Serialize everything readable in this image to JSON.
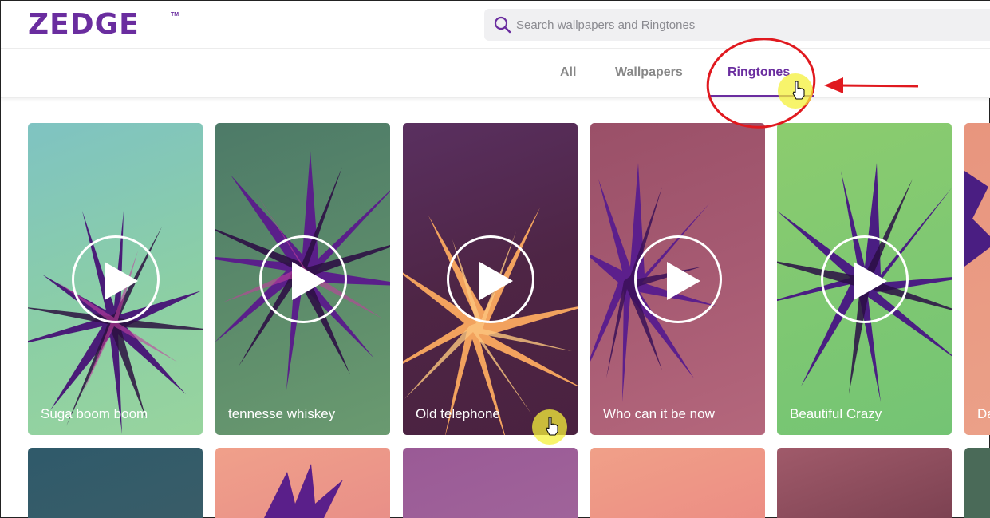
{
  "header": {
    "logo": "ZEDGE",
    "logo_tm": "TM",
    "search": {
      "placeholder": "Search wallpapers and Ringtones",
      "value": ""
    }
  },
  "tabs": [
    {
      "label": "All",
      "active": false
    },
    {
      "label": "Wallpapers",
      "active": false
    },
    {
      "label": "Ringtones",
      "active": true
    }
  ],
  "colors": {
    "brand": "#6a2d9f",
    "annotation": "#e0191f",
    "highlight": "#f4f03a"
  },
  "ringtones": [
    {
      "title": "Suga boom boom",
      "icon": "play-icon"
    },
    {
      "title": "tennesse whiskey",
      "icon": "play-icon"
    },
    {
      "title": "Old telephone",
      "icon": "play-icon"
    },
    {
      "title": "Who can it be now",
      "icon": "play-icon"
    },
    {
      "title": "Beautiful Crazy",
      "icon": "play-icon"
    },
    {
      "title": "Da",
      "icon": "play-icon"
    }
  ]
}
